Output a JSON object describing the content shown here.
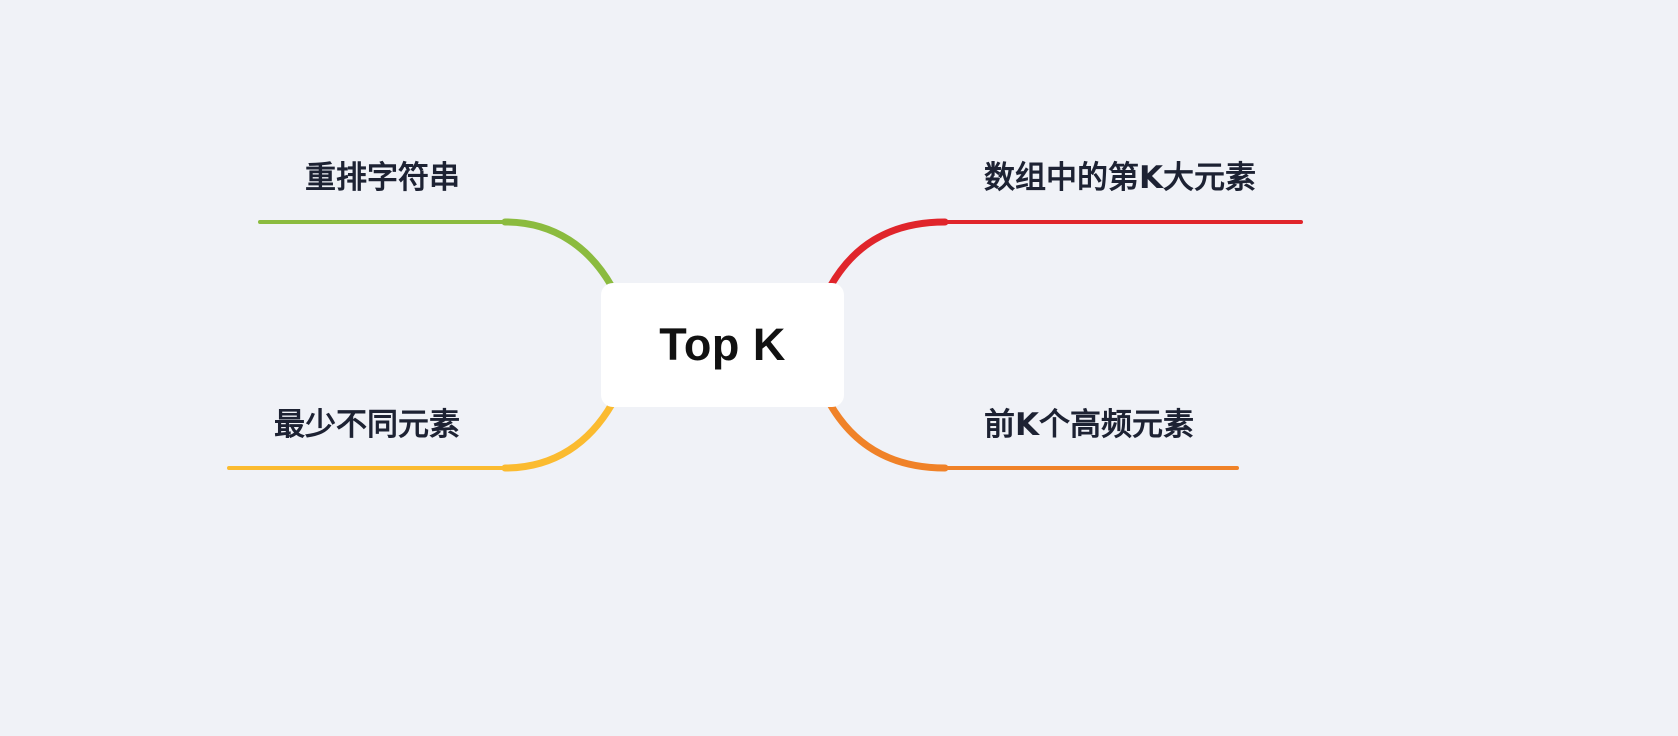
{
  "diagram": {
    "type": "mind-map",
    "central_topic": "Top K",
    "branches": [
      {
        "id": "top-left",
        "label": "重排字符串",
        "color": "#8bbb3f"
      },
      {
        "id": "bottom-left",
        "label": "最少不同元素",
        "color": "#fbbb30"
      },
      {
        "id": "top-right",
        "label": "数组中的第K大元素",
        "color": "#e0252b"
      },
      {
        "id": "bottom-right",
        "label": "前K个高频元素",
        "color": "#f08228"
      }
    ]
  }
}
